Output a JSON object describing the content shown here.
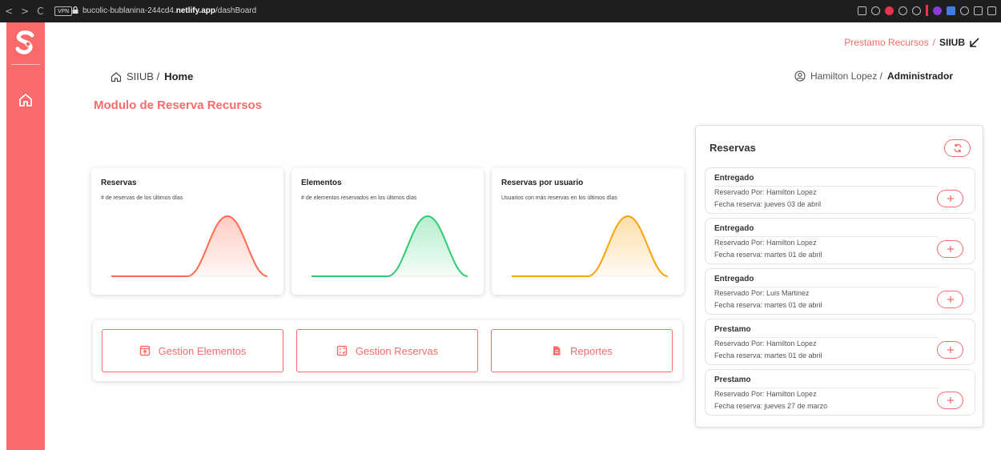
{
  "browser": {
    "url_prefix": "bucolic-bublanina-244cd4.",
    "url_domain": "netlify.app",
    "url_path": "/dashBoard",
    "vpn_label": "VPN",
    "nav_back": "<",
    "nav_forward": ">",
    "nav_reload": "C"
  },
  "header": {
    "top_crumb_app": "Prestamo Recursos",
    "top_crumb_sep": "/",
    "top_crumb_current": "SIIUB",
    "breadcrumb_root": "SIIUB /",
    "breadcrumb_current": "Home",
    "user_name": "Hamilton Lopez /",
    "user_role": "Administrador"
  },
  "page_title": "Modulo de Reserva Recursos",
  "cards": [
    {
      "title": "Reservas",
      "subtitle": "# de reservas de los últimos días",
      "color": "#ff6b50"
    },
    {
      "title": "Elementos",
      "subtitle": "# de elementos reservados en los últimos días",
      "color": "#2ecc71"
    },
    {
      "title": "Reservas por usuario",
      "subtitle": "Usuarios con más reservas en los últimos días",
      "color": "#ffa20a"
    }
  ],
  "actions": [
    {
      "label": "Gestion Elementos",
      "icon": "upload-box-icon"
    },
    {
      "label": "Gestion Reservas",
      "icon": "checklist-icon"
    },
    {
      "label": "Reportes",
      "icon": "document-icon"
    }
  ],
  "reservas": {
    "title": "Reservas",
    "items": [
      {
        "status": "Entregado",
        "by": "Reservado Por: Hamilton Lopez",
        "date": "Fecha reserva: jueves 03 de abril"
      },
      {
        "status": "Entregado",
        "by": "Reservado Por: Hamilton Lopez",
        "date": "Fecha reserva: martes 01 de abril"
      },
      {
        "status": "Entregado",
        "by": "Reservado Por: Luis Martinez",
        "date": "Fecha reserva: martes 01 de abril"
      },
      {
        "status": "Prestamo",
        "by": "Reservado Por: Hamilton Lopez",
        "date": "Fecha reserva: martes 01 de abril"
      },
      {
        "status": "Prestamo",
        "by": "Reservado Por: Hamilton Lopez",
        "date": "Fecha reserva: jueves 27 de marzo"
      }
    ]
  },
  "colors": {
    "accent": "#fa6a6a"
  }
}
